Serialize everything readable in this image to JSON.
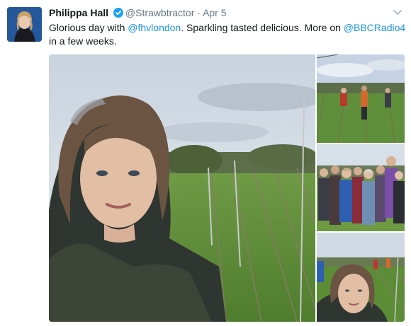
{
  "tweet": {
    "author_name": "Philippa Hall",
    "handle": "@Strawbtractor",
    "separator": "·",
    "date": "Apr 5",
    "text_parts": [
      "Glorious day with ",
      "@fhvlondon",
      ". Sparkling tasted delicious. More on ",
      "@BBCRadio4",
      " in a few weeks."
    ],
    "verified": true
  },
  "icons": {
    "verified": "verified-badge-icon",
    "menu": "chevron-down-icon"
  },
  "colors": {
    "link": "#1b95e0",
    "verified": "#1da1f2",
    "meta": "#657786"
  }
}
